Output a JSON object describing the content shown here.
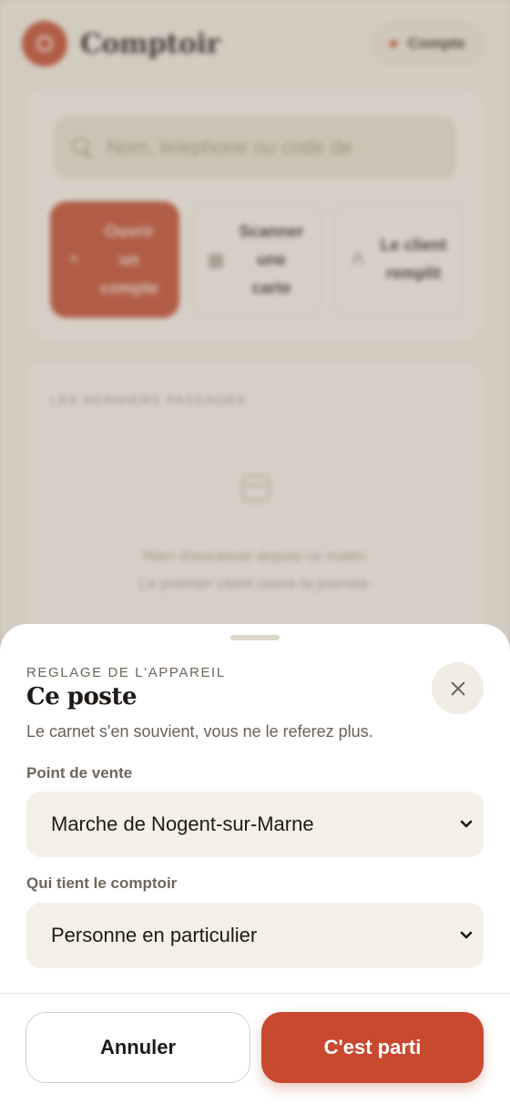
{
  "app": {
    "brand": "Comptoir",
    "account_label": "Compte",
    "search_placeholder": "Nom, telephone ou code de",
    "actions": [
      {
        "label": "Ouvrir un compte",
        "icon": "plus-icon"
      },
      {
        "label": "Scanner une carte",
        "icon": "scan-icon"
      },
      {
        "label": "Le client remplit",
        "icon": "person-icon"
      }
    ],
    "recent": {
      "title": "LES DERNIERS PASSAGES",
      "empty_line1": "Rien d'encaisse depuis ce matin.",
      "empty_line2": "Le premier client ouvre la journee."
    }
  },
  "sheet": {
    "eyebrow": "REGLAGE DE L'APPAREIL",
    "title": "Ce poste",
    "description": "Le carnet s'en souvient, vous ne le referez plus.",
    "point_of_sale": {
      "label": "Point de vente",
      "value": "Marche de Nogent-sur-Marne"
    },
    "counter_holder": {
      "label": "Qui tient le comptoir",
      "value": "Personne en particulier"
    },
    "cancel_label": "Annuler",
    "confirm_label": "C'est parti"
  },
  "colors": {
    "accent": "#c8492f",
    "sheet_bg": "#ffffff",
    "field_bg": "#f4f0e7"
  }
}
